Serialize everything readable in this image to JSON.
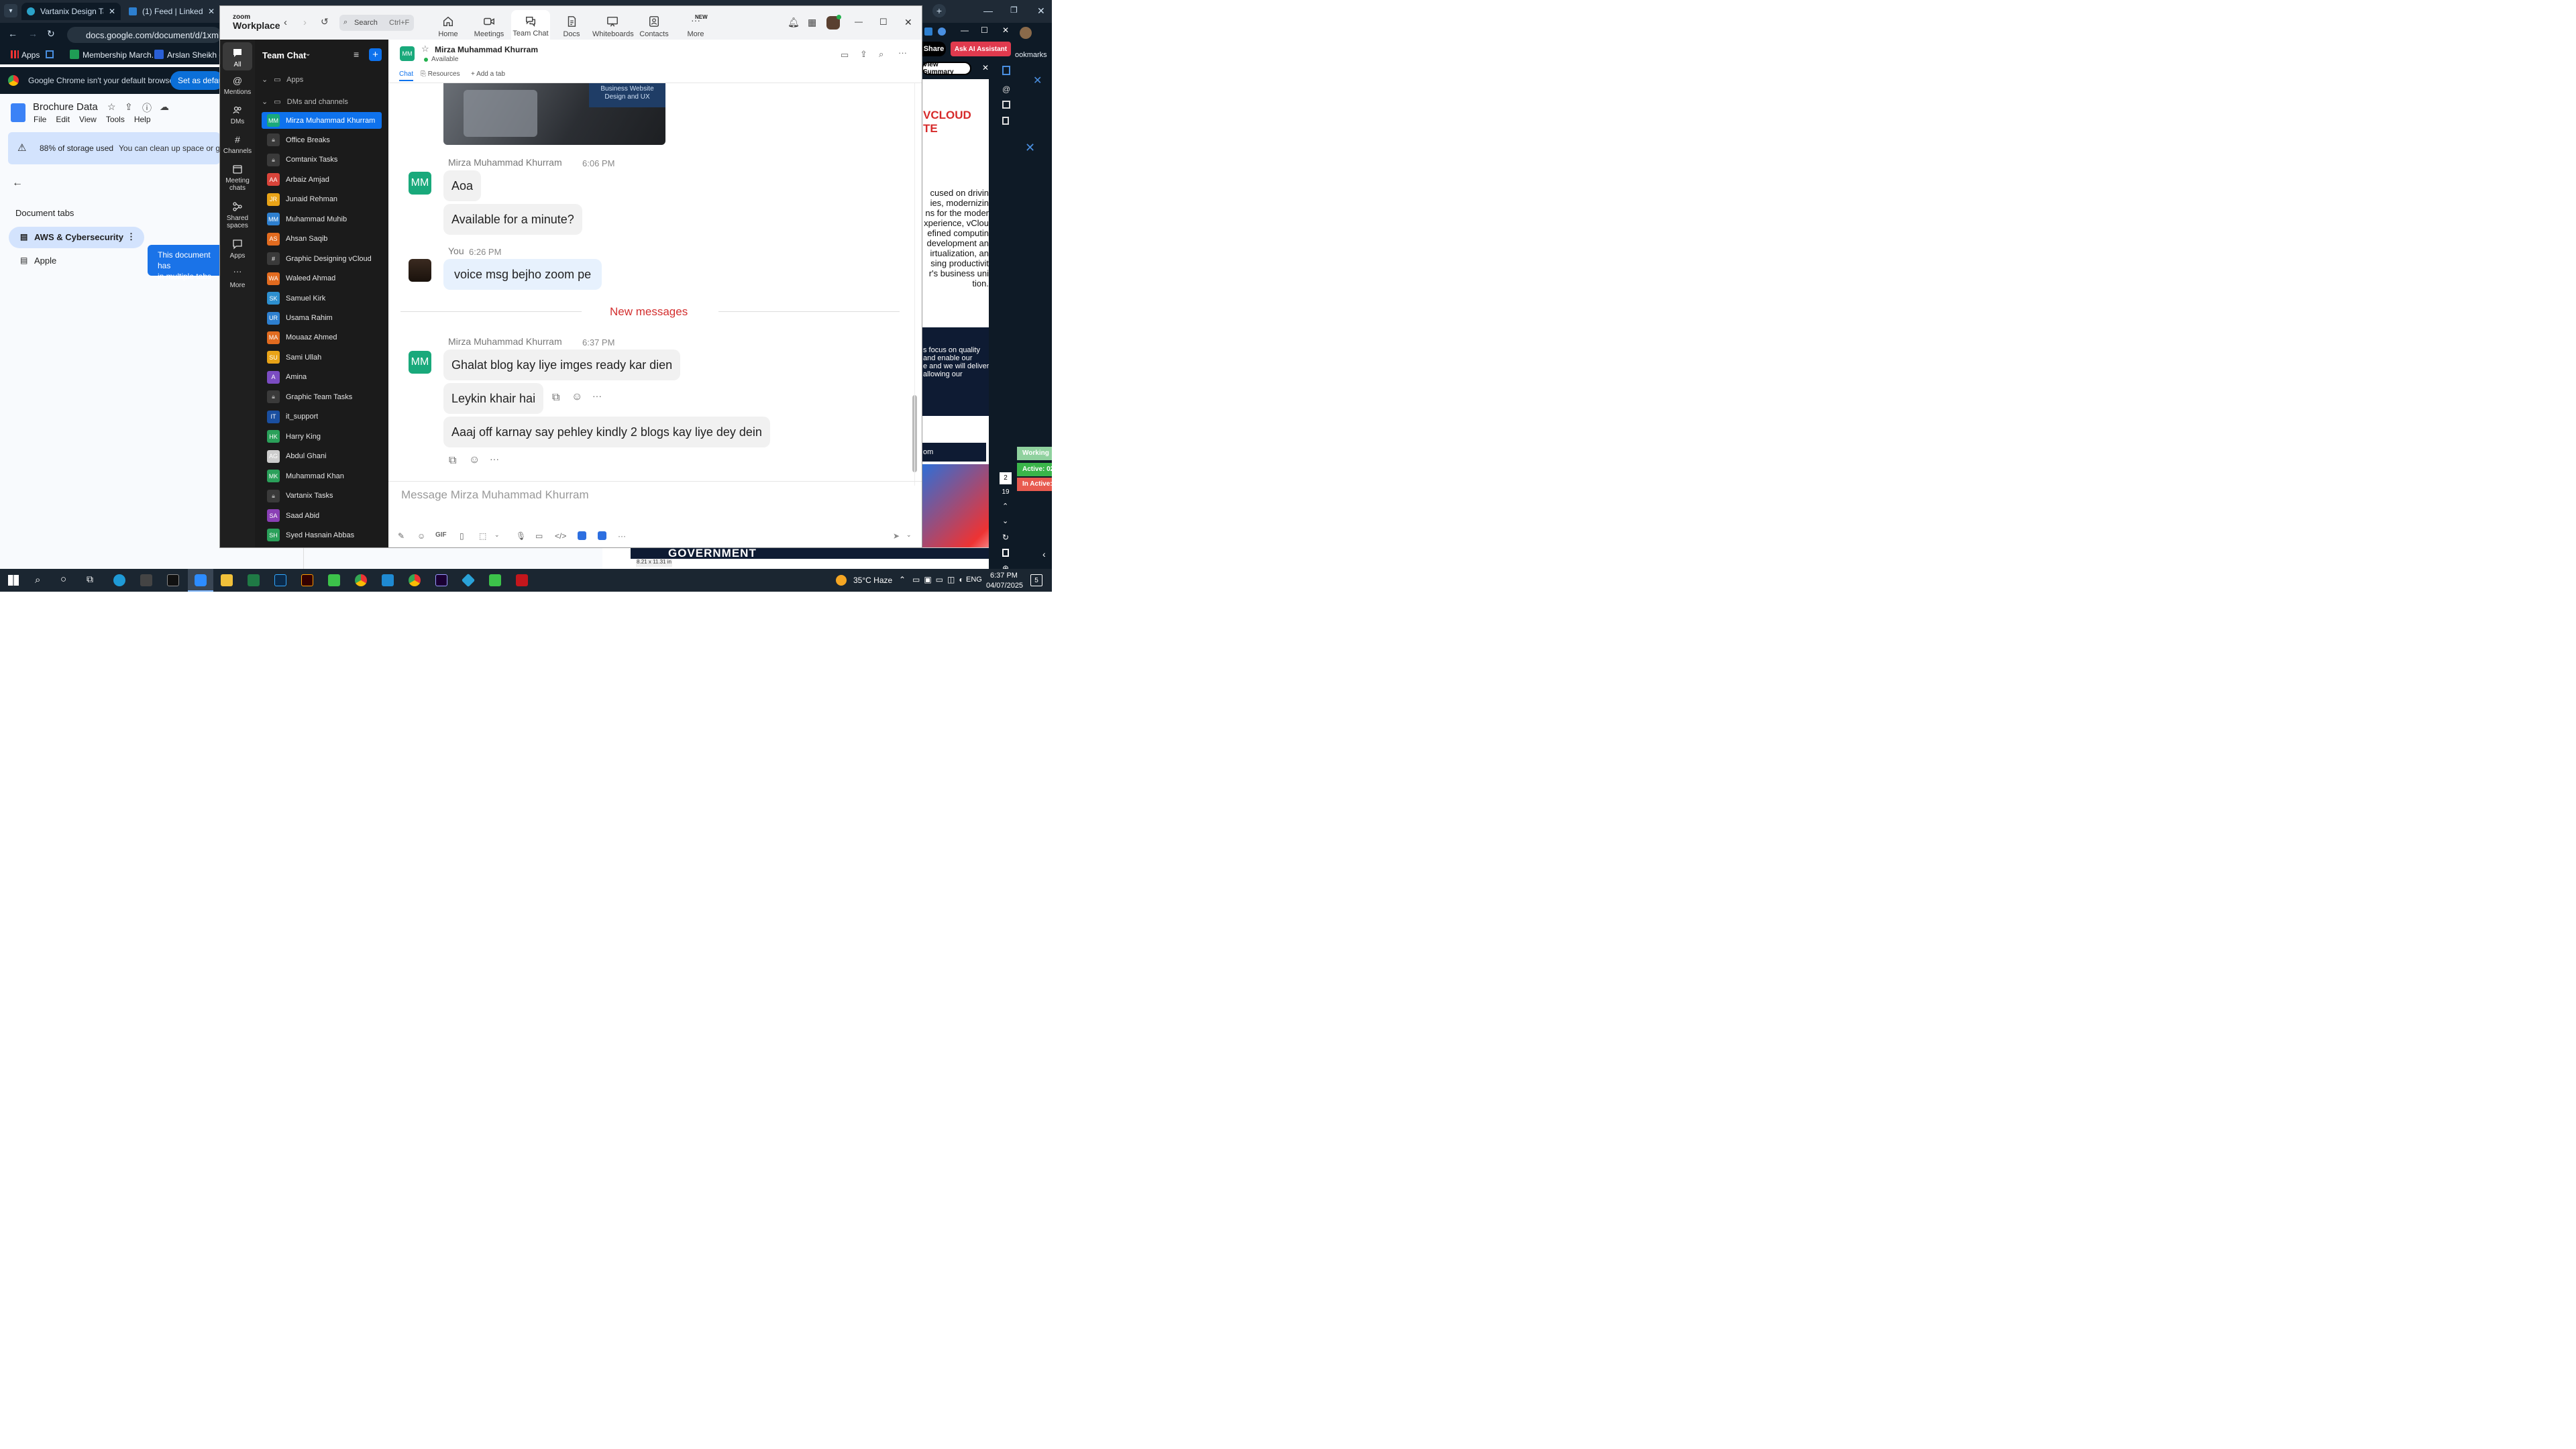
{
  "chrome": {
    "tabs": [
      {
        "label": "Vartanix Design Tasks"
      },
      {
        "label": "(1) Feed | LinkedIn"
      }
    ],
    "url": "docs.google.com/document/d/1xmld6A",
    "bookmarks": {
      "apps": "Apps",
      "items": [
        "Membership March...",
        "Arslan Sheikh on B"
      ]
    },
    "default_browser_msg": "Google Chrome isn't your default browser",
    "set_default_label": "Set as default"
  },
  "docs": {
    "title": "Brochure Data",
    "menu": [
      "File",
      "Edit",
      "View",
      "Tools",
      "Help"
    ],
    "storage": {
      "percent": "88% of storage used",
      "msg": "You can clean up space or g"
    },
    "doc_tabs_title": "Document tabs",
    "tabs": [
      "AWS & Cybersecurity",
      "Apple"
    ],
    "tooltip": "This document has\nin multiple tabs"
  },
  "right": {
    "share": "Share",
    "ask_ai": "Ask AI Assistant",
    "bookmarks": "ookmarks",
    "view_summary": "View Summary",
    "brand": "VCLOUD TE",
    "text_lines": [
      "cused on drivin",
      "ies, modernizin",
      "ns for the moder",
      "xperience, vClou",
      "efined computin",
      "development an",
      "irtualization, an",
      "sing productivit",
      "r's business uni",
      "tion."
    ],
    "dark_lines": [
      "s focus on quality",
      "and enable our",
      "e and we will deliver",
      "allowing our"
    ],
    "com": "om",
    "government": "GOVERNMENT",
    "page_size": "8.21 x 11.31 in",
    "side_nums": [
      "2",
      "19"
    ],
    "status": [
      "Working",
      "Active: 02",
      "In Active:"
    ]
  },
  "zoom": {
    "brand_top": "zoom",
    "brand": "Workplace",
    "search": {
      "label": "Search",
      "shortcut": "Ctrl+F"
    },
    "nav": [
      {
        "label": "Home",
        "icon": "home-icon"
      },
      {
        "label": "Meetings",
        "icon": "video-icon"
      },
      {
        "label": "Team Chat",
        "icon": "chat-icon"
      },
      {
        "label": "Docs",
        "icon": "doc-icon"
      },
      {
        "label": "Whiteboards",
        "icon": "whiteboard-icon"
      },
      {
        "label": "Contacts",
        "icon": "contacts-icon"
      },
      {
        "label": "More",
        "icon": "more-icon",
        "badge": "NEW"
      }
    ],
    "rail": [
      {
        "label": "All"
      },
      {
        "label": "Mentions"
      },
      {
        "label": "DMs"
      },
      {
        "label": "Channels"
      },
      {
        "label": "Meeting chats"
      },
      {
        "label": "Shared spaces"
      },
      {
        "label": "Apps"
      },
      {
        "label": "More"
      }
    ],
    "sidebar": {
      "title": "Team Chat",
      "apps_label": "Apps",
      "dms_label": "DMs and channels",
      "items": [
        {
          "name": "Mirza Muhammad Khurram",
          "init": "MM",
          "color": "#19a97b"
        },
        {
          "name": "Office Breaks",
          "init": "lock",
          "color": "#3a3a3a"
        },
        {
          "name": "Comtanix Tasks",
          "init": "lock",
          "color": "#3a3a3a"
        },
        {
          "name": "Arbaiz Amjad",
          "init": "AA",
          "color": "#d9443a"
        },
        {
          "name": "Junaid Rehman",
          "init": "JR",
          "color": "#e8a317"
        },
        {
          "name": "Muhammad Muhib",
          "init": "MM",
          "color": "#2d7fcf"
        },
        {
          "name": "Ahsan Saqib",
          "init": "AS",
          "color": "#e26b1f"
        },
        {
          "name": "Graphic Designing vCloud",
          "init": "#",
          "color": "#3a3a3a"
        },
        {
          "name": "Waleed Ahmad",
          "init": "WA",
          "color": "#e26b1f"
        },
        {
          "name": "Samuel Kirk",
          "init": "SK",
          "color": "#2d8fcf"
        },
        {
          "name": "Usama Rahim",
          "init": "UR",
          "color": "#2d7fcf"
        },
        {
          "name": "Mouaaz Ahmed",
          "init": "MA",
          "color": "#e26b1f"
        },
        {
          "name": "Sami Ullah",
          "init": "SU",
          "color": "#e8a317"
        },
        {
          "name": "Amina",
          "init": "A",
          "color": "#7b4cc2"
        },
        {
          "name": "Graphic Team Tasks",
          "init": "lock",
          "color": "#3a3a3a"
        },
        {
          "name": "it_support",
          "init": "IT",
          "color": "#1a4fa0"
        },
        {
          "name": "Harry King",
          "init": "HK",
          "color": "#2aa05a"
        },
        {
          "name": "Abdul Ghani",
          "init": "AG",
          "color": "#cccccc"
        },
        {
          "name": "Muhammad Khan",
          "init": "MK",
          "color": "#2aa05a"
        },
        {
          "name": "Vartanix Tasks",
          "init": "lock",
          "color": "#3a3a3a"
        },
        {
          "name": "Saad Abid",
          "init": "SA",
          "color": "#8a3fb5"
        },
        {
          "name": "Syed Hasnain Abbas",
          "init": "SH",
          "color": "#2aa05a"
        }
      ]
    },
    "chat": {
      "contact": "Mirza Muhammad Khurram",
      "status": "Available",
      "avatar": "MM",
      "tabs": [
        "Chat",
        "Resources",
        "Add a tab"
      ],
      "image_caption": [
        "Business Website",
        "Design and UX"
      ],
      "groups": [
        {
          "sender": "Mirza Muhammad Khurram",
          "time": "6:06 PM",
          "messages": [
            "Aoa",
            "Available for a minute?"
          ]
        },
        {
          "sender": "You",
          "time": "6:26 PM",
          "messages": [
            "voice msg bejho zoom pe"
          ]
        }
      ],
      "new_messages": "New messages",
      "group3": {
        "sender": "Mirza Muhammad Khurram",
        "time": "6:37 PM",
        "messages": [
          "Ghalat blog kay liye imges ready kar dien",
          "Leykin khair hai",
          "Aaaj off karnay say pehley kindly 2 blogs kay liye dey dein"
        ]
      },
      "composer_placeholder": "Message Mirza Muhammad Khurram"
    }
  },
  "taskbar": {
    "weather": "35°C Haze",
    "lang": "ENG",
    "time": "6:37 PM",
    "date": "04/07/2025",
    "notif_count": "5"
  }
}
